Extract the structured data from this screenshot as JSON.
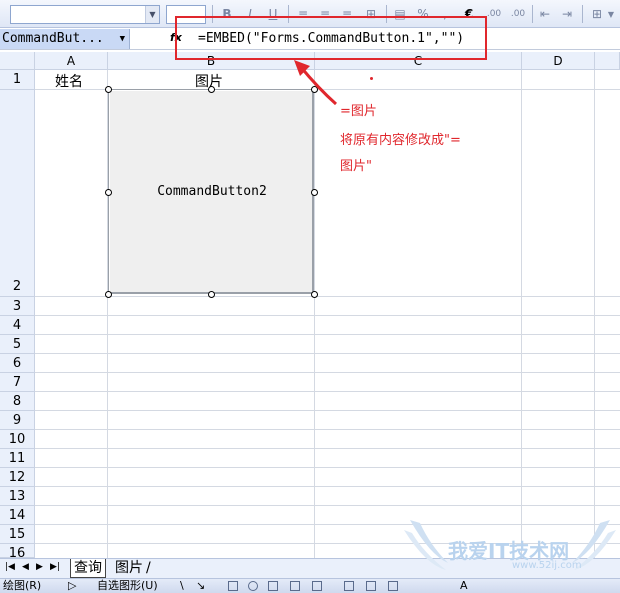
{
  "toolbar": {
    "bold": "B",
    "italic": "I",
    "underline": "U",
    "percent": "%",
    "currency": "€",
    "comma": ",",
    "inc_decimal": ".00",
    "dec_decimal": ".00"
  },
  "formula_bar": {
    "name_box": "CommandBut...",
    "fx": "fx",
    "formula": "=EMBED(\"Forms.CommandButton.1\",\"\")"
  },
  "columns": [
    "A",
    "B",
    "C",
    "D"
  ],
  "rows": [
    "1",
    "2",
    "3",
    "4",
    "5",
    "6",
    "7",
    "8",
    "9",
    "10",
    "11",
    "12",
    "13",
    "14",
    "15",
    "16"
  ],
  "cells": {
    "a1": "姓名",
    "b1": "图片"
  },
  "command_button": {
    "label": "CommandButton2"
  },
  "annotation": {
    "line1": "=图片",
    "line2": "将原有内容修改成\"=",
    "line3": "图片\""
  },
  "sheet_tabs": [
    "查询",
    "图片"
  ],
  "draw_toolbar": {
    "draw_label": "绘图(R)",
    "autoshapes_label": "自选图形(U)"
  },
  "watermark": {
    "text": "我爱IT技术网",
    "url": "www.52ij.com"
  },
  "colors": {
    "annotation_red": "#e0272d",
    "header_bg": "#eaf0fb",
    "namebox_bg": "#c9d9f5"
  }
}
